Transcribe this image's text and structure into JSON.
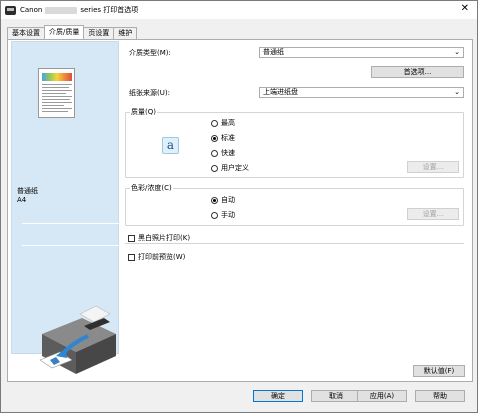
{
  "window": {
    "title_prefix": "Canon",
    "title_suffix": "series 打印首选项",
    "close_glyph": "✕"
  },
  "tabs": [
    {
      "label": "基本设置",
      "active": false
    },
    {
      "label": "介质/质量",
      "active": true
    },
    {
      "label": "页设置",
      "active": false
    },
    {
      "label": "维护",
      "active": false
    }
  ],
  "preview": {
    "media_name": "普通纸",
    "paper_size": "A4"
  },
  "media_type": {
    "label": "介质类型(M):",
    "value": "普通纸",
    "details_button": "首选项..."
  },
  "paper_source": {
    "label": "纸张来源(U):",
    "value": "上端进纸盘"
  },
  "quality": {
    "group_label": "质量(Q)",
    "icon_glyph": "a",
    "options": [
      {
        "label": "最高",
        "checked": false
      },
      {
        "label": "标准",
        "checked": true
      },
      {
        "label": "快速",
        "checked": false
      },
      {
        "label": "用户定义",
        "checked": false
      }
    ],
    "set_button": "设置..."
  },
  "color": {
    "group_label": "色彩/浓度(C)",
    "options": [
      {
        "label": "自动",
        "checked": true
      },
      {
        "label": "手动",
        "checked": false
      }
    ],
    "set_button": "设置..."
  },
  "grayscale": {
    "label": "黑白照片打印(K)",
    "checked": false
  },
  "preview_before": {
    "label": "打印前预览(W)",
    "checked": false
  },
  "defaults_button": "默认值(F)",
  "footer": {
    "ok": "确定",
    "cancel": "取消",
    "apply": "应用(A)",
    "help": "帮助"
  },
  "icons": {
    "dropdown": "⌄"
  }
}
